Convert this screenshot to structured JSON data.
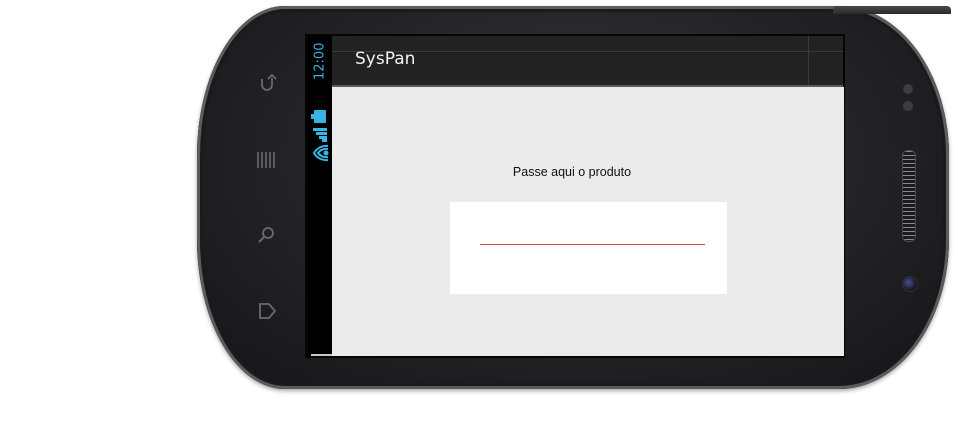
{
  "app": {
    "title": "SysPan"
  },
  "status_bar": {
    "time": "12:00",
    "icons": [
      "battery-icon",
      "signal-icon",
      "wifi-icon"
    ],
    "accent_color": "#38b4e6"
  },
  "main": {
    "prompt": "Passe aqui o produto",
    "input": {
      "value": "",
      "underline_color": "#d94848"
    }
  },
  "hardware_keys": [
    "back-icon",
    "menu-icon",
    "search-icon",
    "home-icon"
  ],
  "colors": {
    "action_bar": "#222222",
    "content_bg": "#ebebeb",
    "phone_body": "#232326"
  }
}
